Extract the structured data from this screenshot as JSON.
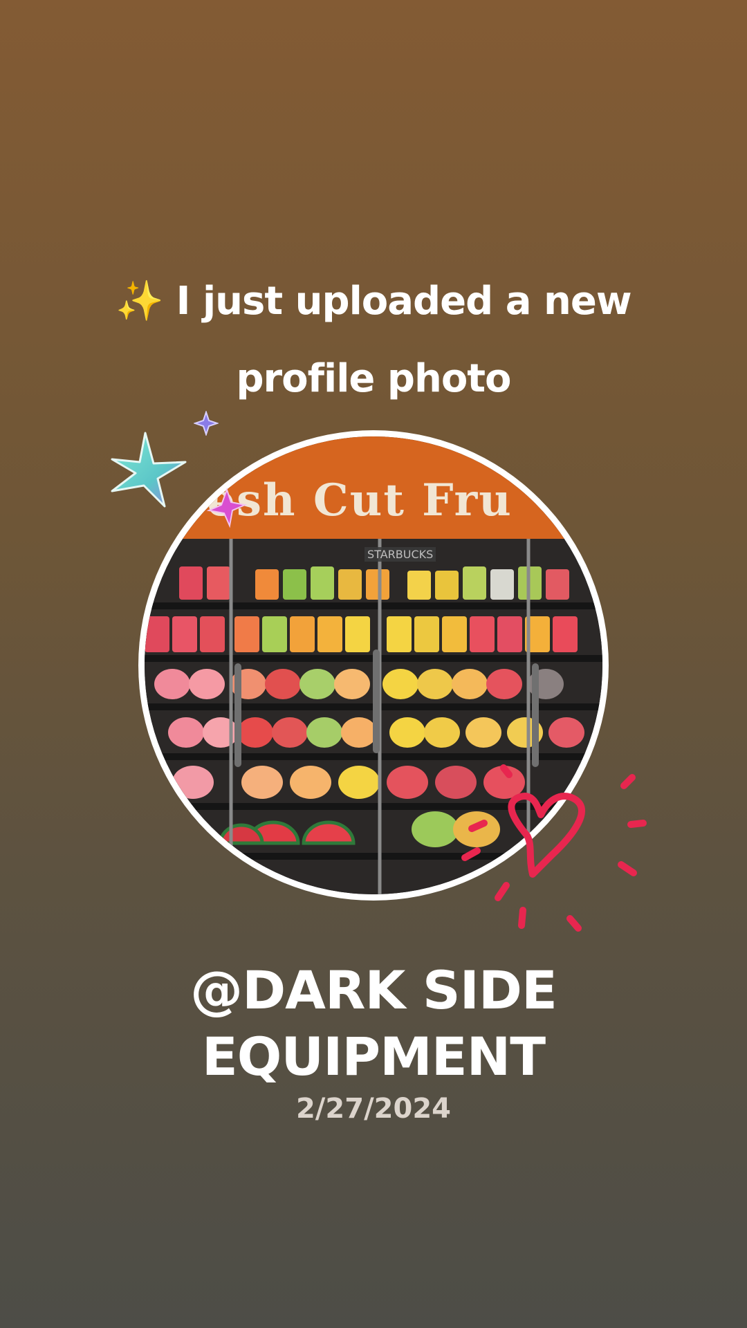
{
  "post": {
    "sparkle_emoji": "✨",
    "headline_line1": "I just uploaded a new",
    "headline_line2": "profile photo",
    "username": "@DARK SIDE",
    "username_line2": "EQUIPMENT",
    "date": "2/27/2024"
  },
  "photo": {
    "sign_text": "esh Cut Fru",
    "store_label": "STARBUCKS"
  },
  "icons": {
    "large_star": "four-point-star-icon",
    "small_star": "small-purple-star-icon",
    "pink_star": "pink-star-icon",
    "heart": "doodle-heart-icon"
  },
  "colors": {
    "background_top": "#835b34",
    "background_bottom": "#4d4d47",
    "heart": "#e8264f",
    "sign": "#d6651f"
  }
}
